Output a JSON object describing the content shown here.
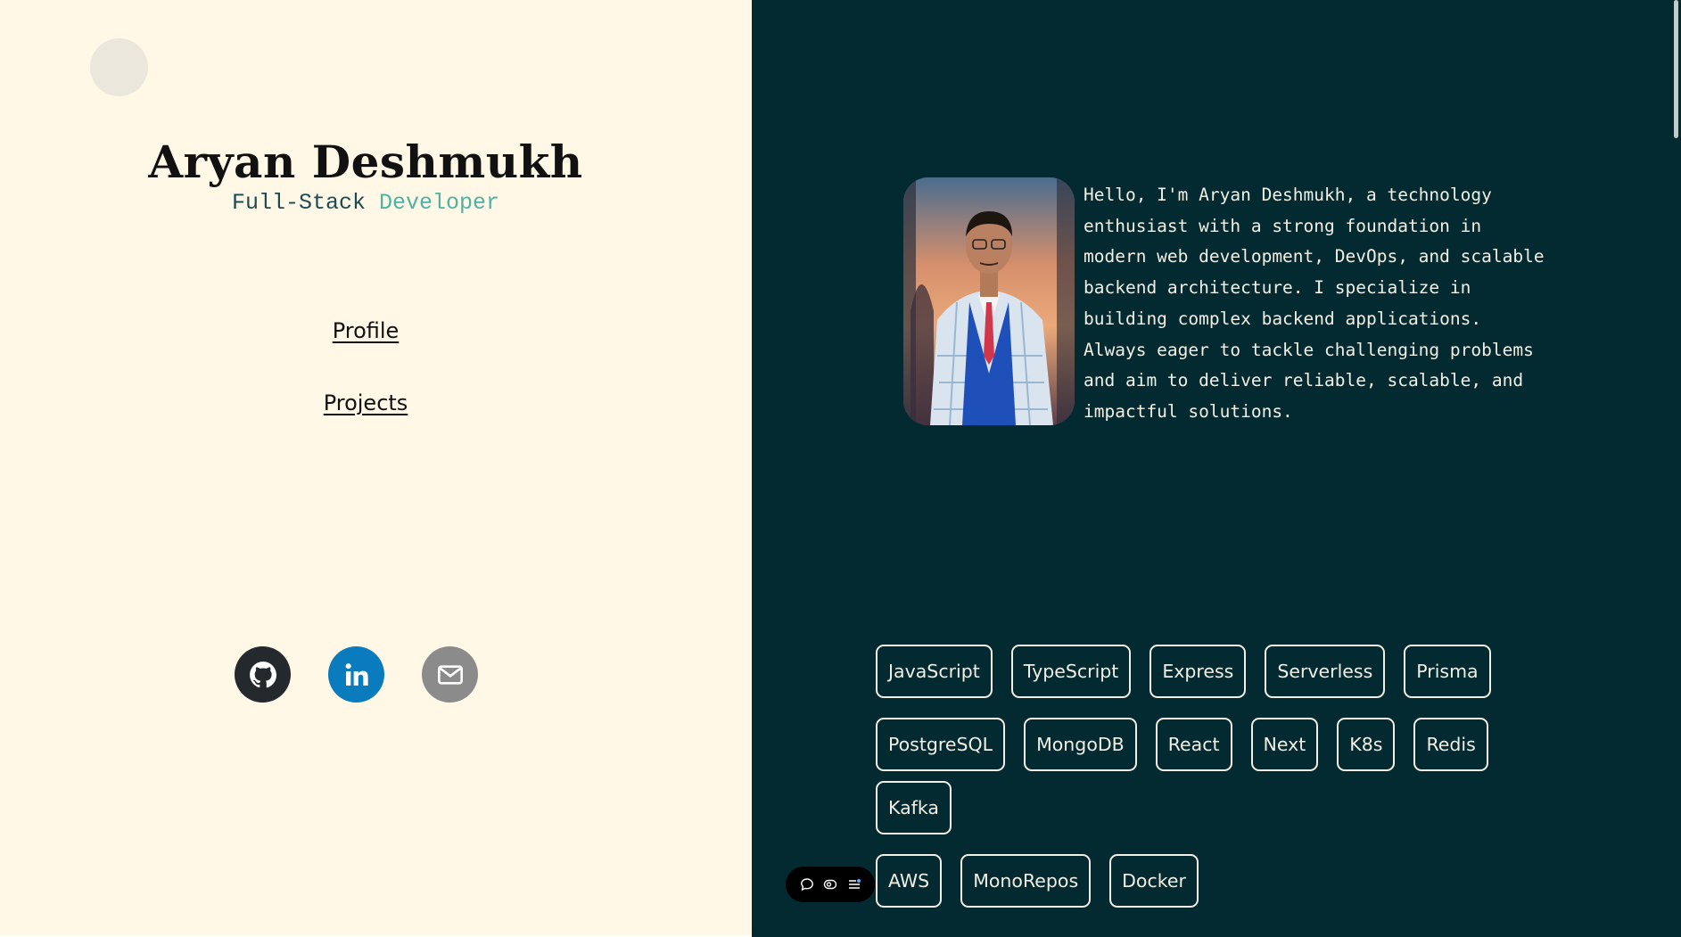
{
  "sidebar": {
    "name": "Aryan Deshmukh",
    "role_part1": "Full-Stack",
    "role_part2": "Developer",
    "nav": {
      "profile": "Profile",
      "projects": "Projects"
    },
    "social": [
      {
        "name": "github",
        "icon": "github-icon",
        "color": "#24292e"
      },
      {
        "name": "linkedin",
        "icon": "linkedin-icon",
        "color": "#0a7bbd"
      },
      {
        "name": "email",
        "icon": "mail-icon",
        "color": "#8b8b8b"
      }
    ]
  },
  "main": {
    "bio": "Hello, I'm Aryan Deshmukh, a technology enthusiast with a strong foundation in modern web development, DevOps, and scalable backend architecture. I specialize in building complex backend applications. Always eager to tackle challenging problems and aim to deliver reliable, scalable, and impactful solutions.",
    "skills": [
      "JavaScript",
      "TypeScript",
      "Express",
      "Serverless",
      "Prisma",
      "PostgreSQL",
      "MongoDB",
      "React",
      "Next",
      "K8s",
      "Redis",
      "Kafka",
      "AWS",
      "MonoRepos",
      "Docker"
    ]
  },
  "toolbar": {
    "icons": [
      "comment-icon",
      "eye-toggle-icon",
      "menu-list-icon"
    ]
  },
  "colors": {
    "left_bg": "#fff8e7",
    "right_bg": "#022a30",
    "accent": "#4fb3a3",
    "text_dark": "#111111",
    "text_light": "#f3efe4"
  }
}
